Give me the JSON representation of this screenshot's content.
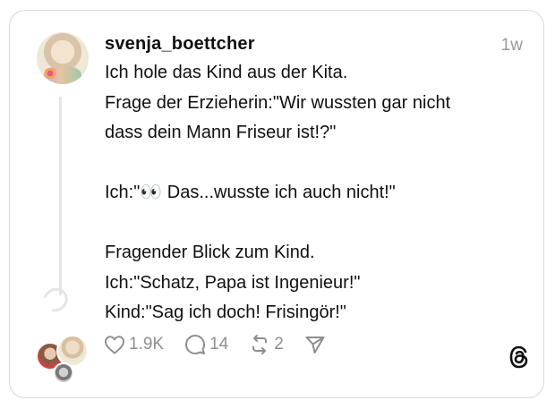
{
  "post": {
    "username": "svenja_boettcher",
    "timestamp": "1w",
    "lines": [
      "Ich hole das Kind aus der Kita.",
      "Frage der Erzieherin:\"Wir wussten gar nicht",
      "dass dein Mann Friseur ist!?\"",
      "",
      "Ich:\"👀 Das...wusste ich auch nicht!\"",
      "",
      "Fragender Blick zum Kind.",
      "Ich:\"Schatz, Papa ist Ingenieur!\"",
      "Kind:\"Sag ich doch! Frisingör!\""
    ]
  },
  "actions": {
    "like_count": "1.9K",
    "reply_count": "14",
    "repost_count": "2"
  },
  "icons": {
    "like": "heart-icon",
    "reply": "speech-bubble-icon",
    "repost": "repost-icon",
    "share": "send-icon",
    "brand": "threads-logo-icon"
  },
  "colors": {
    "text": "#101010",
    "muted": "#8f8f8f",
    "border": "#d9d9d9"
  }
}
